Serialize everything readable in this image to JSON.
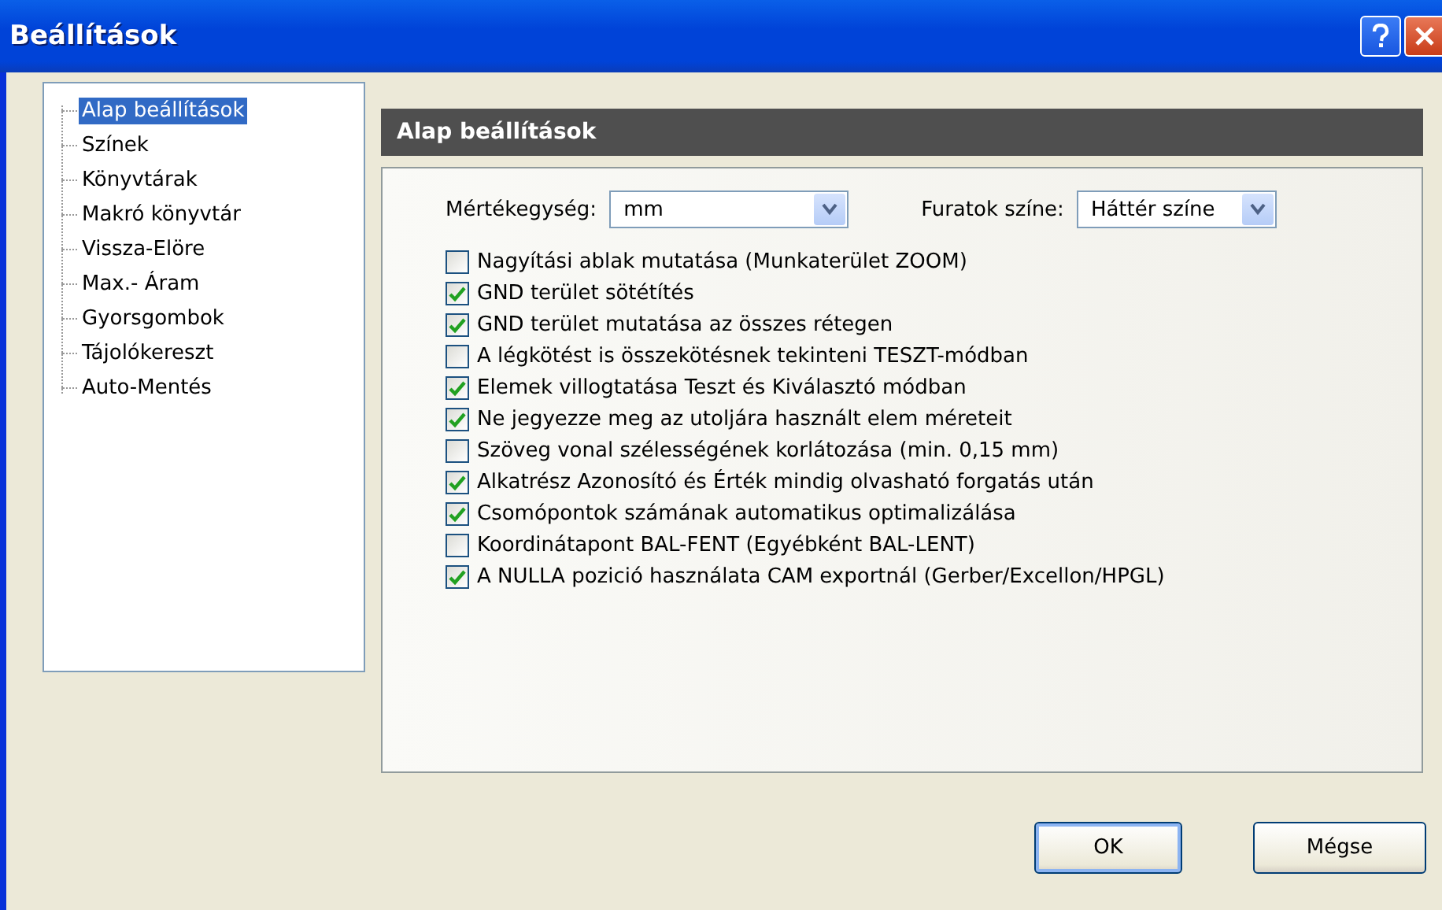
{
  "window": {
    "title": "Beállítások"
  },
  "tree": {
    "items": [
      {
        "label": "Alap beállítások",
        "selected": true
      },
      {
        "label": "Színek",
        "selected": false
      },
      {
        "label": "Könyvtárak",
        "selected": false
      },
      {
        "label": "Makró könyvtár",
        "selected": false
      },
      {
        "label": "Vissza-Elöre",
        "selected": false
      },
      {
        "label": "Max.- Áram",
        "selected": false
      },
      {
        "label": "Gyorsgombok",
        "selected": false
      },
      {
        "label": "Tájolókereszt",
        "selected": false
      },
      {
        "label": "Auto-Mentés",
        "selected": false
      }
    ]
  },
  "panel": {
    "title": "Alap beállítások",
    "unit": {
      "label": "Mértékegység:",
      "value": "mm"
    },
    "hole_color": {
      "label": "Furatok színe:",
      "value": "Háttér színe"
    },
    "options": [
      {
        "label": "Nagyítási ablak mutatása (Munkaterület ZOOM)",
        "checked": false
      },
      {
        "label": "GND terület sötétítés",
        "checked": true
      },
      {
        "label": "GND terület mutatása az összes rétegen",
        "checked": true
      },
      {
        "label": "A légkötést is összekötésnek tekinteni TESZT-módban",
        "checked": false
      },
      {
        "label": "Elemek villogtatása Teszt és Kiválasztó módban",
        "checked": true
      },
      {
        "label": "Ne jegyezze meg az utoljára használt elem méreteit",
        "checked": true
      },
      {
        "label": "Szöveg vonal szélességének korlátozása (min. 0,15 mm)",
        "checked": false
      },
      {
        "label": "Alkatrész Azonosító és Érték mindig olvasható forgatás után",
        "checked": true
      },
      {
        "label": "Csomópontok számának automatikus optimalizálása",
        "checked": true
      },
      {
        "label": "Koordinátapont BAL-FENT (Egyébként BAL-LENT)",
        "checked": false
      },
      {
        "label": "A NULLA pozició használata CAM exportnál (Gerber/Excellon/HPGL)",
        "checked": true
      }
    ]
  },
  "buttons": [
    {
      "label": "OK",
      "default": true
    },
    {
      "label": "Mégse",
      "default": false
    }
  ]
}
